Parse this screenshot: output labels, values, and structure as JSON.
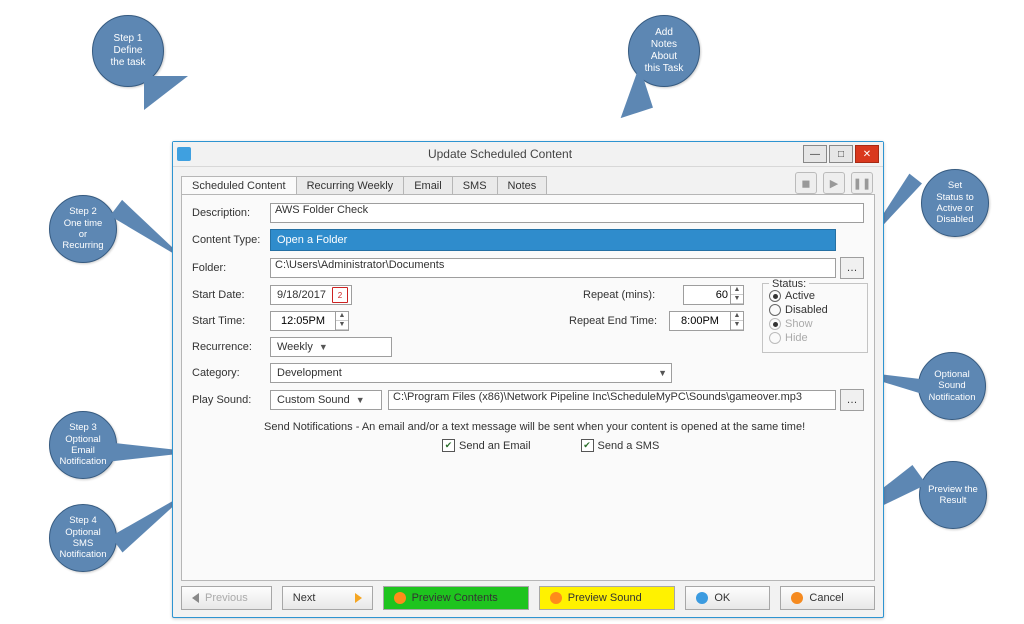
{
  "window": {
    "title": "Update Scheduled Content"
  },
  "tabs": [
    "Scheduled Content",
    "Recurring Weekly",
    "Email",
    "SMS",
    "Notes"
  ],
  "labels": {
    "description": "Description:",
    "content_type": "Content Type:",
    "folder": "Folder:",
    "start_date": "Start Date:",
    "start_time": "Start Time:",
    "repeat_mins": "Repeat (mins):",
    "repeat_end": "Repeat End Time:",
    "recurrence": "Recurrence:",
    "category": "Category:",
    "play_sound": "Play Sound:",
    "status": "Status:"
  },
  "values": {
    "description": "AWS Folder Check",
    "content_type": "Open a Folder",
    "folder": "C:\\Users\\Administrator\\Documents",
    "start_date": "9/18/2017",
    "start_time": "12:05PM",
    "repeat_mins": "60",
    "repeat_end": "8:00PM",
    "recurrence": "Weekly",
    "category": "Development",
    "play_sound_mode": "Custom Sound",
    "play_sound_path": "C:\\Program Files (x86)\\Network Pipeline Inc\\ScheduleMyPC\\Sounds\\gameover.mp3"
  },
  "status": {
    "active": "Active",
    "disabled": "Disabled",
    "show": "Show",
    "hide": "Hide"
  },
  "notify_text": "Send Notifications - An email and/or a text message will be sent when your content is opened at the same time!",
  "checks": {
    "email": "Send an Email",
    "sms": "Send a SMS"
  },
  "footer": {
    "previous": "Previous",
    "next": "Next",
    "preview_contents": "Preview Contents",
    "preview_sound": "Preview Sound",
    "ok": "OK",
    "cancel": "Cancel"
  },
  "callouts": {
    "step1": "Step 1\nDefine\nthe task",
    "add_notes": "Add\nNotes\nAbout\nthis Task",
    "step2": "Step 2\nOne time\nor\nRecurring",
    "set_status": "Set\nStatus to\nActive or\nDisabled",
    "optional_sound": "Optional\nSound\nNotification",
    "step3": "Step 3\nOptional\nEmail\nNotification",
    "step4": "Step 4\nOptional\nSMS\nNotification",
    "preview": "Preview the\nResult"
  }
}
